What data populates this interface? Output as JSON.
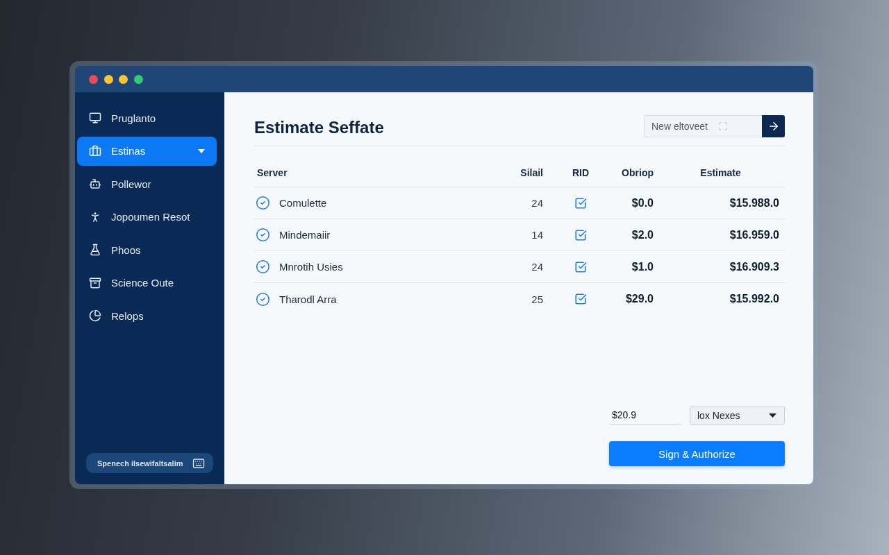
{
  "window": {
    "controls": [
      {
        "color": "#ec4b55"
      },
      {
        "color": "#f7c631"
      },
      {
        "color": "#f4c530"
      },
      {
        "color": "#2ecc71"
      }
    ]
  },
  "sidebar": {
    "items": [
      {
        "label": "Pruglanto",
        "selected": false,
        "has_submenu": false
      },
      {
        "label": "Estinas",
        "selected": true,
        "has_submenu": true
      },
      {
        "label": "Pollewor",
        "selected": false,
        "has_submenu": false
      },
      {
        "label": "Jopoumen Resot",
        "selected": false,
        "has_submenu": false
      },
      {
        "label": "Phoos",
        "selected": false,
        "has_submenu": false
      },
      {
        "label": "Science Oute",
        "selected": false,
        "has_submenu": false
      },
      {
        "label": "Relops",
        "selected": false,
        "has_submenu": false
      }
    ],
    "footer": {
      "label": "Spenech ilsewifaltsalim"
    }
  },
  "main": {
    "title": "Estimate Seffate",
    "search": {
      "placeholder": "New eltoveet"
    },
    "table": {
      "columns": [
        {
          "label": "Server"
        },
        {
          "label": "Silail"
        },
        {
          "label": "RID"
        },
        {
          "label": "Obriop"
        },
        {
          "label": "Estimate"
        }
      ],
      "rows": [
        {
          "server": "Comulette",
          "silail": "24",
          "rid_checked": true,
          "obriop": "$0.0",
          "estimate": "$15.988.0"
        },
        {
          "server": "Mindemaiir",
          "silail": "14",
          "rid_checked": true,
          "obriop": "$2.0",
          "estimate": "$16.959.0"
        },
        {
          "server": "Mnrotih Usies",
          "silail": "24",
          "rid_checked": true,
          "obriop": "$1.0",
          "estimate": "$16.909.3"
        },
        {
          "server": "Tharodl Arra",
          "silail": "25",
          "rid_checked": true,
          "obriop": "$29.0",
          "estimate": "$15.992.0"
        }
      ]
    },
    "amount": {
      "value": "$20.9"
    },
    "select": {
      "value": "lox Nexes"
    },
    "submit": {
      "label": "Sign & Authorize"
    }
  }
}
